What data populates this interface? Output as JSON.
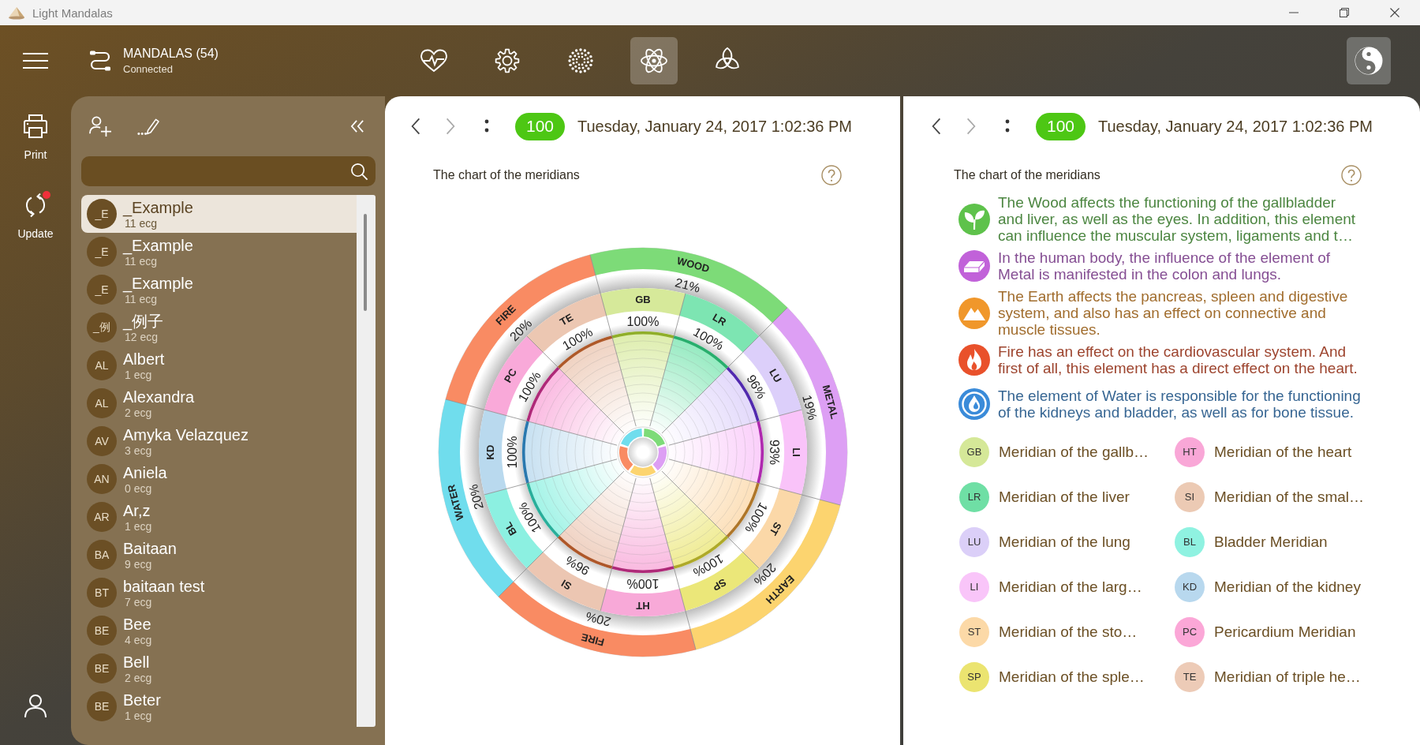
{
  "window": {
    "title": "Light Mandalas"
  },
  "rail": {
    "items": [
      {
        "kind": "print",
        "label": "Print",
        "alert": false
      },
      {
        "kind": "update",
        "label": "Update",
        "alert": true
      }
    ]
  },
  "header": {
    "title": "MANDALAS (54)",
    "status": "Connected"
  },
  "toolbar": [
    {
      "kind": "pulse",
      "selected": false
    },
    {
      "kind": "gear",
      "selected": false
    },
    {
      "kind": "burst",
      "selected": false
    },
    {
      "kind": "atom",
      "selected": true
    },
    {
      "kind": "knot",
      "selected": false
    }
  ],
  "sidebar": {
    "items": [
      {
        "initials": "_E",
        "name": "_Example",
        "count": "11 ecg",
        "selected": true
      },
      {
        "initials": "_E",
        "name": "_Example",
        "count": "11 ecg",
        "selected": false
      },
      {
        "initials": "_E",
        "name": "_Example",
        "count": "11 ecg",
        "selected": false
      },
      {
        "initials": "_例",
        "name": "_例子",
        "count": "12 ecg",
        "selected": false
      },
      {
        "initials": "AL",
        "name": "Albert",
        "count": "1 ecg",
        "selected": false
      },
      {
        "initials": "AL",
        "name": "Alexandra",
        "count": "2 ecg",
        "selected": false
      },
      {
        "initials": "AV",
        "name": "Amyka Velazquez",
        "count": "3 ecg",
        "selected": false
      },
      {
        "initials": "AN",
        "name": "Aniela",
        "count": "0 ecg",
        "selected": false
      },
      {
        "initials": "AR",
        "name": "Ar,z",
        "count": "1 ecg",
        "selected": false
      },
      {
        "initials": "BA",
        "name": "Baitaan",
        "count": "9 ecg",
        "selected": false
      },
      {
        "initials": "BT",
        "name": "baitaan test",
        "count": "7 ecg",
        "selected": false
      },
      {
        "initials": "BE",
        "name": "Bee",
        "count": "4 ecg",
        "selected": false
      },
      {
        "initials": "BE",
        "name": "Bell",
        "count": "2 ecg",
        "selected": false
      },
      {
        "initials": "BE",
        "name": "Beter",
        "count": "1 ecg",
        "selected": false
      }
    ]
  },
  "chart_panel": {
    "back": {
      "disabled": false
    },
    "forward": {
      "disabled": true
    },
    "badge": "100",
    "date": "Tuesday, January 24, 2017 1:02:36 PM",
    "title": "The chart of the meridians",
    "mandala": {
      "elements": [
        {
          "name": "WOOD",
          "percent": "21%",
          "color": "#7ddb78"
        },
        {
          "name": "METAL",
          "percent": "19%",
          "color": "#dd9ff4"
        },
        {
          "name": "EARTH",
          "percent": "20%",
          "color": "#fcd46f"
        },
        {
          "name": "FIRE",
          "percent": "20%",
          "color": "#f98b63"
        },
        {
          "name": "WATER",
          "percent": "20%",
          "color": "#70dded"
        },
        {
          "name": "FIRE",
          "percent": "20%",
          "color": "#f98b63"
        }
      ],
      "meridians": [
        {
          "code": "GB",
          "percent": "100%",
          "color": "#d6e99a"
        },
        {
          "code": "LR",
          "percent": "100%",
          "color": "#7de5b2"
        },
        {
          "code": "LU",
          "percent": "96%",
          "color": "#dccffa"
        },
        {
          "code": "LI",
          "percent": "93%",
          "color": "#f9c3f9"
        },
        {
          "code": "ST",
          "percent": "100%",
          "color": "#fbd8a8"
        },
        {
          "code": "SP",
          "percent": "100%",
          "color": "#ebe779"
        },
        {
          "code": "HT",
          "percent": "100%",
          "color": "#f8a9d8"
        },
        {
          "code": "SI",
          "percent": "96%",
          "color": "#ecc6b2"
        },
        {
          "code": "BL",
          "percent": "100%",
          "color": "#8cf0e1"
        },
        {
          "code": "KD",
          "percent": "100%",
          "color": "#b9d9ee"
        },
        {
          "code": "PC",
          "percent": "100%",
          "color": "#f9a9d9"
        },
        {
          "code": "TE",
          "percent": "100%",
          "color": "#ecc7b2"
        }
      ]
    }
  },
  "info_panel": {
    "back": {
      "disabled": false
    },
    "forward": {
      "disabled": true
    },
    "badge": "100",
    "date": "Tuesday, January 24, 2017 1:02:36 PM",
    "title": "The chart of the meridians",
    "descriptions": [
      {
        "kind": "wood",
        "color": "#5ec24b",
        "text": "The Wood affects the functioning of the gallbladder and liver, as well as the eyes. In addition, this element can influence the muscular system, ligaments and t…"
      },
      {
        "kind": "metal",
        "color": "#c162d9",
        "text": "In the human body, the influence of the element of Metal is manifested in the colon and lungs."
      },
      {
        "kind": "earth",
        "color": "#f0972b",
        "text": "The Earth affects the pancreas, spleen and digestive system, and also has an effect on connective and muscle tissues."
      },
      {
        "kind": "fire",
        "color": "#e9512b",
        "text": "Fire has an effect on the cardiovascular system. And first of all, this element has a direct effect on the heart."
      },
      {
        "kind": "water",
        "color": "#3a8bd9",
        "text": "The element of Water is responsible for the functioning of the kidneys and bladder, as well as for bone tissue."
      }
    ],
    "legend_columns": [
      {
        "items": [
          {
            "code": "GB",
            "name": "Meridian of the gallb…",
            "color": "#d5e898"
          },
          {
            "code": "LR",
            "name": "Meridian of the liver",
            "color": "#6fdfa5"
          },
          {
            "code": "LU",
            "name": "Meridian of the lung",
            "color": "#dbcff8"
          },
          {
            "code": "LI",
            "name": "Meridian of the larg…",
            "color": "#f9c5f9"
          },
          {
            "code": "ST",
            "name": "Meridian of the sto…",
            "color": "#fcd9a7"
          },
          {
            "code": "SP",
            "name": "Meridian of the sple…",
            "color": "#ebe470"
          }
        ]
      },
      {
        "items": [
          {
            "code": "HT",
            "name": "Meridian of the heart",
            "color": "#f9a7d7"
          },
          {
            "code": "SI",
            "name": "Meridian of the smal…",
            "color": "#eccab4"
          },
          {
            "code": "BL",
            "name": "Bladder Meridian",
            "color": "#8ff2e1"
          },
          {
            "code": "KD",
            "name": "Meridian of the kidney",
            "color": "#b8d8ee"
          },
          {
            "code": "PC",
            "name": "Pericardium Meridian",
            "color": "#fba7d7"
          },
          {
            "code": "TE",
            "name": "Meridian of triple he…",
            "color": "#edcbb7"
          }
        ]
      }
    ]
  }
}
